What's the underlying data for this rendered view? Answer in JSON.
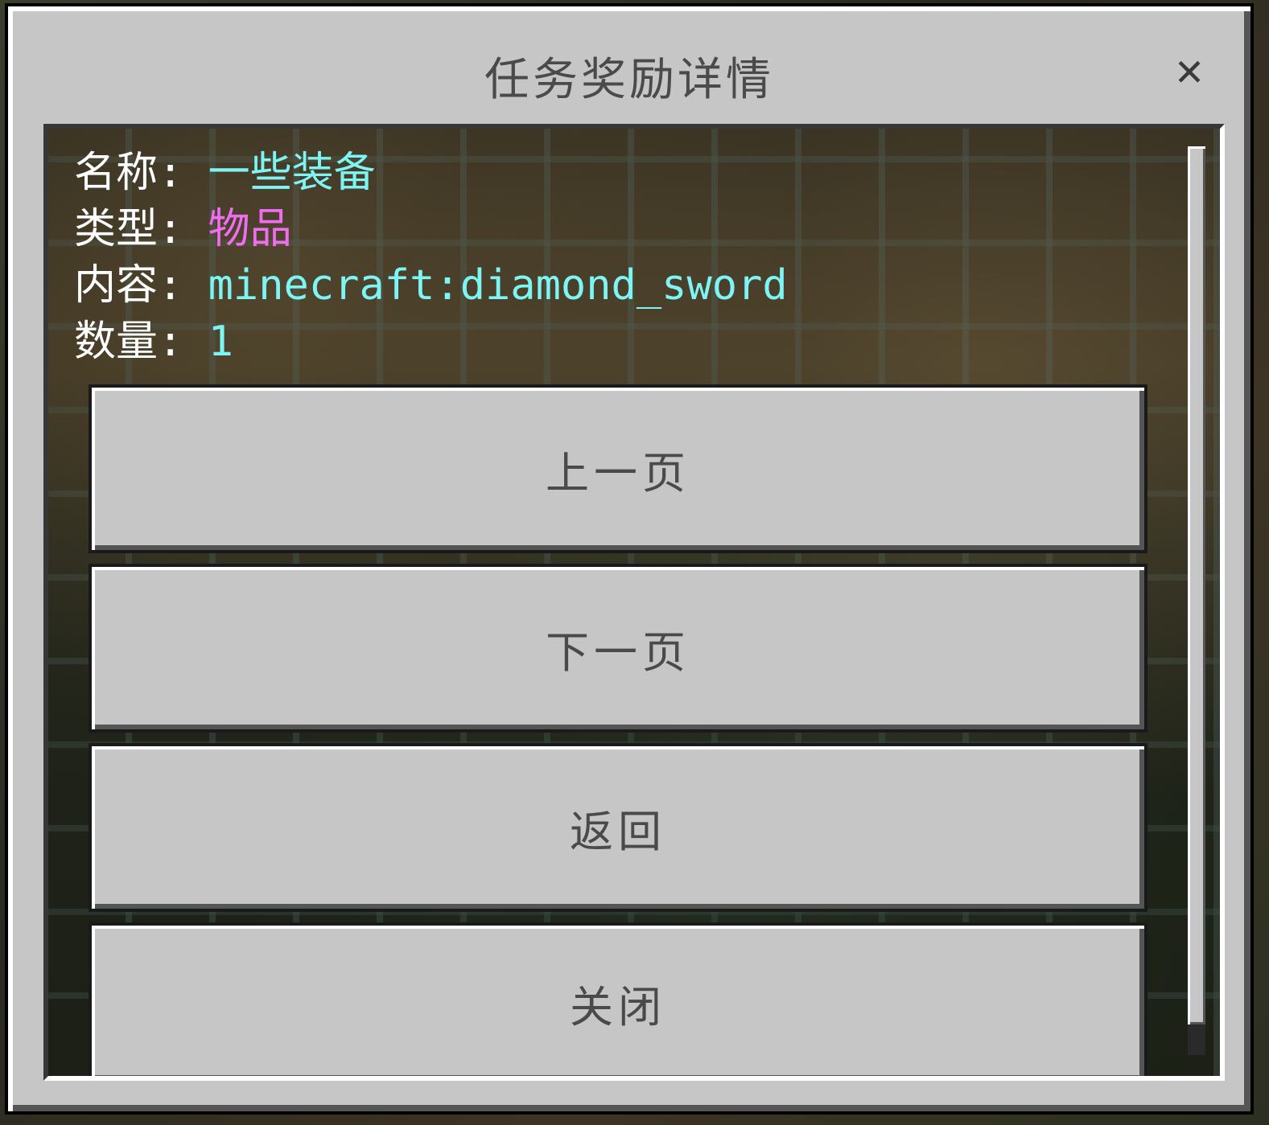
{
  "dialog": {
    "title": "任务奖励详情",
    "close_label": "✕"
  },
  "info": {
    "name_label": "名称:",
    "name_value": "一些装备",
    "type_label": "类型:",
    "type_value": "物品",
    "content_label": "内容:",
    "content_value": "minecraft:diamond_sword",
    "count_label": "数量:",
    "count_value": "1"
  },
  "buttons": {
    "prev": "上一页",
    "next": "下一页",
    "back": "返回",
    "close": "关闭"
  },
  "colors": {
    "panel": "#c6c6c6",
    "value_cyan": "#7ef5f5",
    "value_magenta": "#f06cf0",
    "text_dark": "#4a4a4a"
  }
}
